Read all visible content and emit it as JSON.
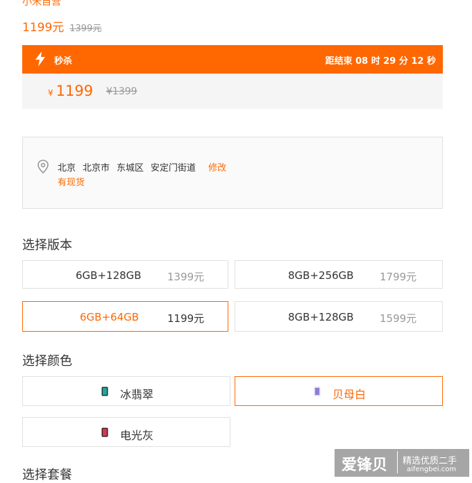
{
  "store": "小米自营",
  "price": {
    "current": "1199元",
    "original": "1399元"
  },
  "flash_sale": {
    "title": "秒杀",
    "countdown": "距结束 08 时 29 分 12 秒",
    "currency": "¥",
    "price": "1199",
    "original": "¥1399",
    "accent": "#ff6700"
  },
  "address": {
    "parts": [
      "北京",
      "北京市",
      "东城区",
      "安定门街道"
    ],
    "edit_label": "修改",
    "stock": "有现货"
  },
  "version_section": {
    "title": "选择版本"
  },
  "versions": [
    {
      "name": "6GB+128GB",
      "price": "1399元",
      "selected": false
    },
    {
      "name": "8GB+256GB",
      "price": "1799元",
      "selected": false
    },
    {
      "name": "6GB+64GB",
      "price": "1199元",
      "selected": true
    },
    {
      "name": "8GB+128GB",
      "price": "1599元",
      "selected": false
    }
  ],
  "color_section": {
    "title": "选择颜色"
  },
  "colors": [
    {
      "name": "冰翡翠",
      "selected": false,
      "swatch": "#1f6f6a"
    },
    {
      "name": "贝母白",
      "selected": true,
      "swatch": "#8a7fd1"
    },
    {
      "name": "电光灰",
      "selected": false,
      "swatch": "#b0243a"
    }
  ],
  "bundle_section": {
    "title": "选择套餐"
  },
  "watermark": {
    "brand": "爱锋贝",
    "slogan": "精选优质二手",
    "url": "aifengbei.com"
  }
}
